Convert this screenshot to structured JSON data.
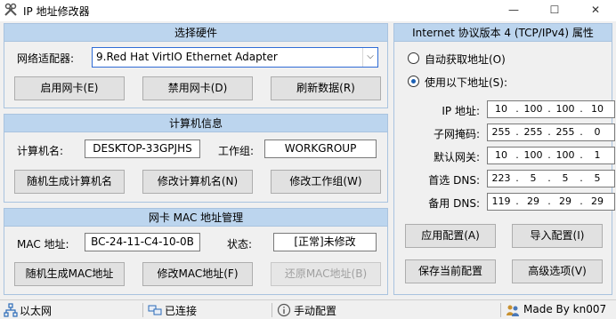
{
  "window": {
    "title": "IP 地址修改器",
    "minimize": "—",
    "maximize": "☐",
    "close": "✕"
  },
  "hardware": {
    "header": "选择硬件",
    "adapter_label": "网络适配器:",
    "adapter_value": "9.Red Hat VirtIO Ethernet Adapter",
    "enable_button": "启用网卡(E)",
    "disable_button": "禁用网卡(D)",
    "refresh_button": "刷新数据(R)"
  },
  "computer": {
    "header": "计算机信息",
    "name_label": "计算机名:",
    "name_value": "DESKTOP-33GPJHS",
    "group_label": "工作组:",
    "group_value": "WORKGROUP",
    "random_name_button": "随机生成计算机名",
    "modify_name_button": "修改计算机名(N)",
    "modify_group_button": "修改工作组(W)"
  },
  "mac": {
    "header": "网卡 MAC 地址管理",
    "mac_label": "MAC 地址:",
    "mac_value": "BC-24-11-C4-10-0B",
    "status_label": "状态:",
    "status_value": "[正常]未修改",
    "random_button": "随机生成MAC地址",
    "modify_button": "修改MAC地址(F)",
    "restore_button": "还原MAC地址(B)"
  },
  "tcpip": {
    "header": "Internet 协议版本 4 (TCP/IPv4) 属性",
    "auto_option": "自动获取地址(O)",
    "manual_option": "使用以下地址(S):",
    "selected": "manual",
    "fields": [
      {
        "label": "IP 地址:",
        "octets": [
          "10",
          "100",
          "100",
          "10"
        ]
      },
      {
        "label": "子网掩码:",
        "octets": [
          "255",
          "255",
          "255",
          "0"
        ]
      },
      {
        "label": "默认网关:",
        "octets": [
          "10",
          "100",
          "100",
          "1"
        ]
      },
      {
        "label": "首选 DNS:",
        "octets": [
          "223",
          "5",
          "5",
          "5"
        ]
      },
      {
        "label": "备用 DNS:",
        "octets": [
          "119",
          "29",
          "29",
          "29"
        ]
      }
    ],
    "apply_button": "应用配置(A)",
    "import_button": "导入配置(I)",
    "save_button": "保存当前配置",
    "advanced_button": "高级选项(V)"
  },
  "statusbar": {
    "connection_type": "以太网",
    "connection_state": "已连接",
    "config_mode": "手动配置",
    "author": "Made By kn007"
  },
  "colors": {
    "panel_header": "#bcd5ee",
    "panel_border": "#a9c3df",
    "accent": "#1a5fb4"
  },
  "icons": [
    "tools-icon",
    "network-icon",
    "connected-icon",
    "info-icon",
    "users-icon"
  ]
}
